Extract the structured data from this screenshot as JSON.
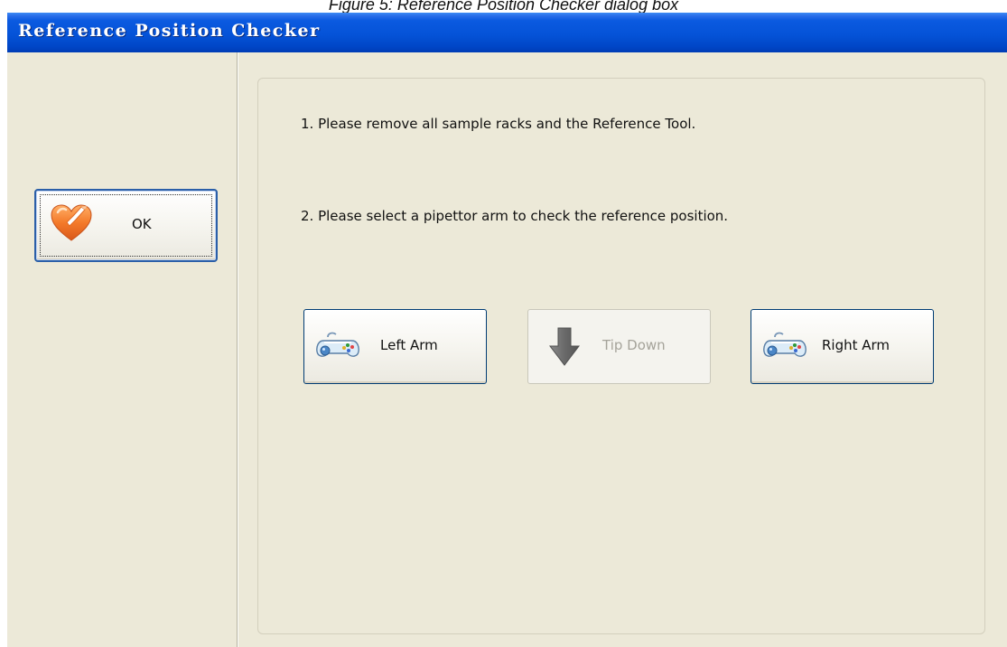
{
  "top_caption": "Figure 5: Reference Position Checker dialog box",
  "window": {
    "title": "Reference Position Checker"
  },
  "left_panel": {
    "ok_button": {
      "label": "OK",
      "icon": "heart-check-icon"
    }
  },
  "content": {
    "instruction_1": "1. Please remove all sample racks and the Reference Tool.",
    "instruction_2": "2. Please select a pipettor arm to check the reference position.",
    "buttons": {
      "left_arm": {
        "label": "Left Arm",
        "icon": "gamepad-icon",
        "enabled": true
      },
      "tip_down": {
        "label": "Tip Down",
        "icon": "down-arrow-icon",
        "enabled": false
      },
      "right_arm": {
        "label": "Right Arm",
        "icon": "gamepad-icon",
        "enabled": true
      }
    }
  },
  "colors": {
    "title_bar": "#0553d8",
    "window_bg": "#ECE9D8",
    "button_border": "#003c74",
    "disabled_text": "#a5a39a"
  }
}
